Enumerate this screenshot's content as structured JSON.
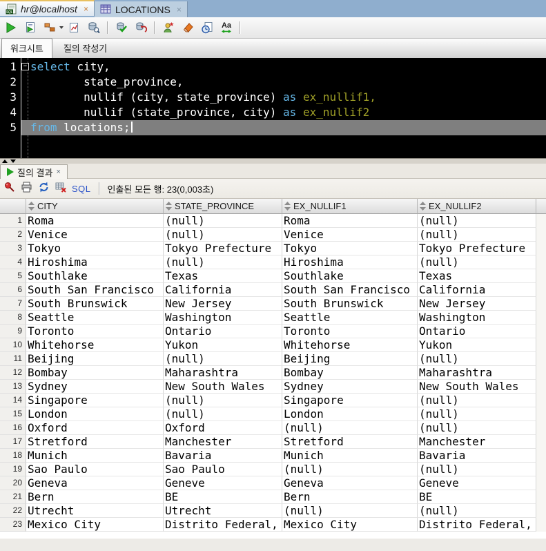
{
  "ui": {
    "close_glyph": "×",
    "fold_glyph": "−"
  },
  "document_tabs": [
    {
      "label": "hr@localhost",
      "icon": "sql-worksheet-icon",
      "active": true
    },
    {
      "label": "LOCATIONS",
      "icon": "table-icon",
      "active": false
    }
  ],
  "main_toolbar": {
    "icons": [
      "run-statement",
      "run-script",
      "explain-plan",
      "autotrace",
      "sql-tuning-advisor",
      "commit",
      "rollback",
      "monitor-sql",
      "clear",
      "sql-history",
      "change-case"
    ],
    "change_case_label": "Aa"
  },
  "worksheet_tabs": [
    {
      "label": "워크시트",
      "active": true
    },
    {
      "label": "질의 작성기",
      "active": false
    }
  ],
  "editor": {
    "current_line_index": 4,
    "cursor_line_index": 4,
    "colors": {
      "keyword": "#66B8E8",
      "alias": "#A0A028",
      "plain": "#FFFFFF",
      "background": "#000000",
      "current_line": "#7F7F7F"
    },
    "lines": [
      [
        {
          "t": "select",
          "c": "kw"
        },
        {
          "t": " city,",
          "c": "pl"
        }
      ],
      [
        {
          "t": "        state_province,",
          "c": "pl"
        }
      ],
      [
        {
          "t": "        nullif (city, state_province) ",
          "c": "pl"
        },
        {
          "t": "as",
          "c": "kw"
        },
        {
          "t": " ",
          "c": "pl"
        },
        {
          "t": "ex_nullif1,",
          "c": "al"
        }
      ],
      [
        {
          "t": "        nullif (state_province, city) ",
          "c": "pl"
        },
        {
          "t": "as",
          "c": "kw"
        },
        {
          "t": " ",
          "c": "pl"
        },
        {
          "t": "ex_nullif2",
          "c": "al"
        }
      ],
      [
        {
          "t": "from",
          "c": "kw"
        },
        {
          "t": " locations;",
          "c": "pl"
        }
      ]
    ]
  },
  "results": {
    "tab_label": "질의 결과",
    "toolbar": {
      "icons": [
        "pin",
        "print",
        "refresh",
        "delete-grid",
        "sql-link"
      ],
      "sql_label": "SQL",
      "status": "인출된 모든 행: 23(0,003초)"
    }
  },
  "grid": {
    "gutter_width": 38,
    "columns": [
      {
        "label": "CITY",
        "width": 199
      },
      {
        "label": "STATE_PROVINCE",
        "width": 172
      },
      {
        "label": "EX_NULLIF1",
        "width": 196
      },
      {
        "label": "EX_NULLIF2",
        "width": 172
      }
    ],
    "rows": [
      [
        "Roma",
        "(null)",
        "Roma",
        "(null)"
      ],
      [
        "Venice",
        "(null)",
        "Venice",
        "(null)"
      ],
      [
        "Tokyo",
        "Tokyo Prefecture",
        "Tokyo",
        "Tokyo Prefecture"
      ],
      [
        "Hiroshima",
        "(null)",
        "Hiroshima",
        "(null)"
      ],
      [
        "Southlake",
        "Texas",
        "Southlake",
        "Texas"
      ],
      [
        "South San Francisco",
        "California",
        "South San Francisco",
        "California"
      ],
      [
        "South Brunswick",
        "New Jersey",
        "South Brunswick",
        "New Jersey"
      ],
      [
        "Seattle",
        "Washington",
        "Seattle",
        "Washington"
      ],
      [
        "Toronto",
        "Ontario",
        "Toronto",
        "Ontario"
      ],
      [
        "Whitehorse",
        "Yukon",
        "Whitehorse",
        "Yukon"
      ],
      [
        "Beijing",
        "(null)",
        "Beijing",
        "(null)"
      ],
      [
        "Bombay",
        "Maharashtra",
        "Bombay",
        "Maharashtra"
      ],
      [
        "Sydney",
        "New South Wales",
        "Sydney",
        "New South Wales"
      ],
      [
        "Singapore",
        "(null)",
        "Singapore",
        "(null)"
      ],
      [
        "London",
        "(null)",
        "London",
        "(null)"
      ],
      [
        "Oxford",
        "Oxford",
        "(null)",
        "(null)"
      ],
      [
        "Stretford",
        "Manchester",
        "Stretford",
        "Manchester"
      ],
      [
        "Munich",
        "Bavaria",
        "Munich",
        "Bavaria"
      ],
      [
        "Sao Paulo",
        "Sao Paulo",
        "(null)",
        "(null)"
      ],
      [
        "Geneva",
        "Geneve",
        "Geneva",
        "Geneve"
      ],
      [
        "Bern",
        "BE",
        "Bern",
        "BE"
      ],
      [
        "Utrecht",
        "Utrecht",
        "(null)",
        "(null)"
      ],
      [
        "Mexico City",
        "Distrito Federal,",
        "Mexico City",
        "Distrito Federal,"
      ]
    ]
  }
}
